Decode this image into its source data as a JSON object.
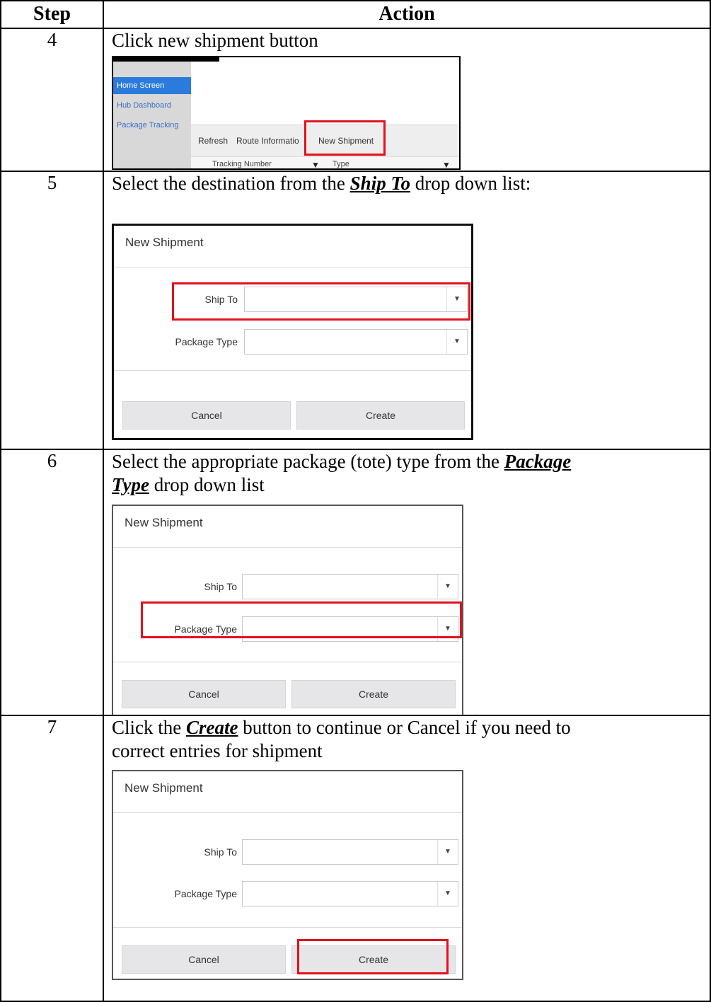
{
  "table": {
    "headers": {
      "step": "Step",
      "action": "Action"
    },
    "rows": [
      {
        "step": "4",
        "text": "Click new shipment button"
      },
      {
        "step": "5",
        "text_before": "Select the destination from the ",
        "keyword": "Ship To",
        "text_after": " drop down list:"
      },
      {
        "step": "6",
        "line1_before": "Select the appropriate package (tote) type from the ",
        "keyword_line1": "Package",
        "keyword_line2": "Type",
        "line2_after": " drop down list"
      },
      {
        "step": "7",
        "line1_before": "Click the ",
        "keyword": "Create",
        "line1_after": " button to continue or Cancel if you need to",
        "line2": "correct entries for shipment"
      }
    ]
  },
  "screenshot_step4": {
    "sidebar": [
      "Home Screen",
      "Hub Dashboard",
      "Package Tracking"
    ],
    "toolbar": {
      "refresh": "Refresh",
      "route_info": "Route Informatio",
      "new_shipment": "New Shipment"
    },
    "columns": {
      "tracking": "Tracking Number",
      "type": "Type"
    }
  },
  "dialog": {
    "title": "New Shipment",
    "ship_to_label": "Ship To",
    "package_type_label": "Package Type",
    "cancel": "Cancel",
    "create": "Create"
  },
  "colors": {
    "highlight": "#e1121b",
    "sidebar_active": "#2a7bdc"
  }
}
